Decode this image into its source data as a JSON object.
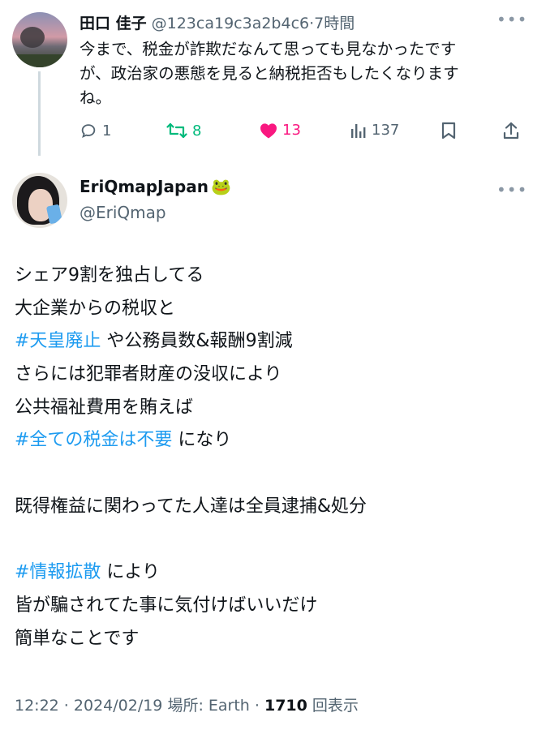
{
  "reply_tweet": {
    "author_name": "田口 佳子",
    "handle": "@123ca19c3a2b4c6",
    "time": "·7時間",
    "more_icon": "more-horizontal-icon",
    "lines": [
      "今まで、税金が詐欺だなんて思っても見なかったです",
      "が、政治家の悪態を見ると納税拒否もしたくなります",
      "ね。"
    ],
    "actions": {
      "reply_count": "1",
      "retweet_count": "8",
      "like_count": "13",
      "views_count": "137"
    }
  },
  "main_tweet": {
    "author_name": "EriQmapJapan",
    "author_emoji": "🐸",
    "handle": "@EriQmap",
    "lines": [
      [
        {
          "text": "シェア9割を独占してる",
          "tag": false
        }
      ],
      [
        {
          "text": "大企業からの税収と",
          "tag": false
        }
      ],
      [
        {
          "text": "#天皇廃止",
          "tag": true
        },
        {
          "text": " や公務員数&報酬9割減",
          "tag": false
        }
      ],
      [
        {
          "text": "さらには犯罪者財産の没収により",
          "tag": false
        }
      ],
      [
        {
          "text": "公共福祉費用を賄えば",
          "tag": false
        }
      ],
      [
        {
          "text": "#全ての税金は不要",
          "tag": true
        },
        {
          "text": " になり",
          "tag": false
        }
      ],
      [],
      [
        {
          "text": "既得権益に関わってた人達は全員逮捕&処分",
          "tag": false
        }
      ],
      [],
      [
        {
          "text": "#情報拡散",
          "tag": true
        },
        {
          "text": " により",
          "tag": false
        }
      ],
      [
        {
          "text": "皆が騙されてた事に気付けばいいだけ",
          "tag": false
        }
      ],
      [
        {
          "text": "簡単なことです",
          "tag": false
        }
      ]
    ],
    "meta": {
      "time": "12:22",
      "date": "2024/02/19",
      "location_label": "場所: Earth",
      "views": "1710",
      "views_label": "回表示"
    }
  },
  "colors": {
    "text": "#0f1419",
    "muted": "#536471",
    "link": "#1d9bf0",
    "retweet": "#00ba7c",
    "like": "#f91880"
  }
}
